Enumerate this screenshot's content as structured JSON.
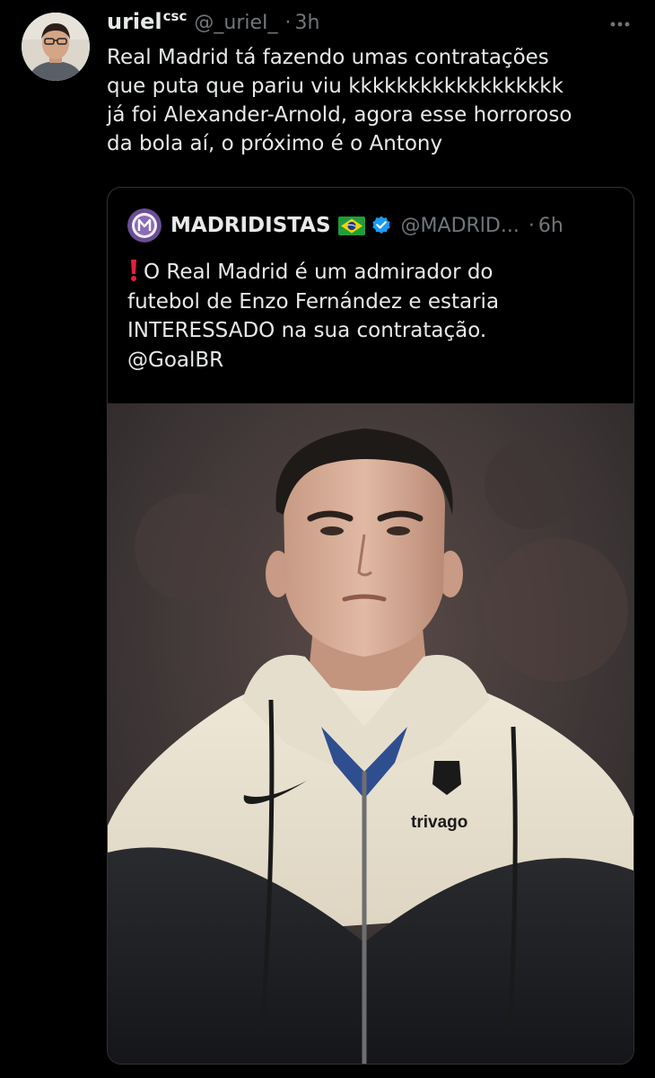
{
  "tweet": {
    "author_name": "uriel",
    "author_name_sup": "csc",
    "handle": "@_urieI_",
    "separator": "·",
    "time": "3h",
    "text_lines": [
      "Real Madrid tá fazendo umas contratações",
      "que puta que pariu viu kkkkkkkkkkkkkkkkkk",
      "já foi Alexander-Arnold, agora esse horroroso",
      "da bola aí, o próximo é o Antony"
    ]
  },
  "quote": {
    "author_name": "MADRIDISTAS",
    "handle": "@MADRlD...",
    "separator": "·",
    "time": "6h",
    "text_lines": [
      "O Real Madrid é um admirador do",
      "futebol de Enzo Fernández e estaria",
      "INTERESSADO na sua contratação.",
      "@GoalBR"
    ],
    "photo": {
      "jacket_sponsor": "trivago"
    }
  },
  "icons": {
    "more": "more-options-icon",
    "flag": "brazil-flag-icon",
    "verified": "verified-badge-icon",
    "exclamation": "red-exclamation-icon"
  },
  "colors": {
    "background": "#000000",
    "text": "#e7e9ea",
    "secondary_text": "#71767b",
    "border": "#2f3336",
    "verified": "#1d9bf0",
    "exclamation": "#e0223b"
  }
}
